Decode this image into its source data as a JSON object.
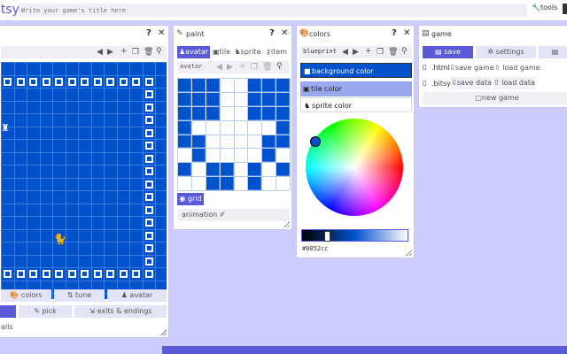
{
  "app": {
    "logo": "itsy",
    "title_placeholder": "Write your game's title here",
    "tools_label": "tools"
  },
  "room_panel": {
    "tab_colors": "colors",
    "tab_tune": "tune",
    "tab_avatar": "avatar",
    "btn_pick": "pick",
    "btn_exits": "exits & endings",
    "walls_label": "alls"
  },
  "paint_panel": {
    "title": "paint",
    "tabs": [
      "avatar",
      "tile",
      "sprite",
      "item"
    ],
    "name_value": "avatar",
    "grid_label": "grid",
    "animation_label": "animation"
  },
  "colors_panel": {
    "title": "colors",
    "palette_name": "blueprint",
    "background_label": "background color",
    "tile_label": "tile color",
    "sprite_label": "sprite color",
    "hex_value": "#0052cc"
  },
  "game_panel": {
    "title": "game",
    "tabs": [
      "save",
      "settings"
    ],
    "html_label": ".html",
    "save_game": "save game",
    "load_game": "load game",
    "bitsy_label": ".bitsy",
    "save_data": "save data",
    "load_data": "load data",
    "new_game": "new game"
  },
  "colors": {
    "background": "#0052cc",
    "tile": "#ffffff",
    "accent": "#5a5ad8"
  }
}
